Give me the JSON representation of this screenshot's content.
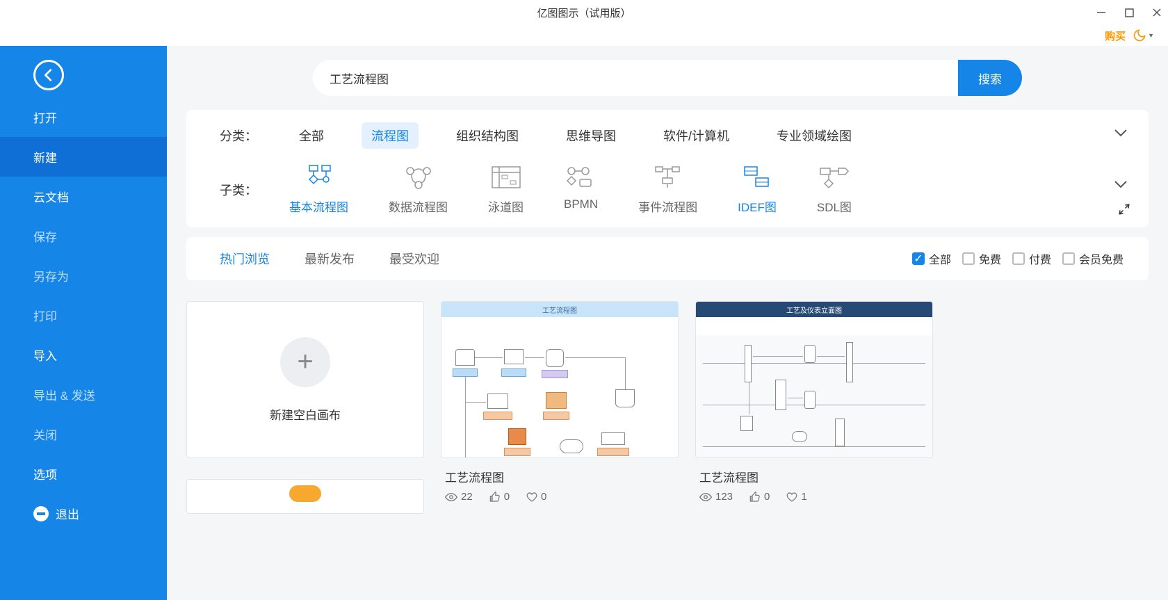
{
  "title": "亿图图示（试用版）",
  "buy": "购买",
  "sidebar": {
    "items": [
      {
        "label": "打开"
      },
      {
        "label": "新建"
      },
      {
        "label": "云文档"
      },
      {
        "label": "保存"
      },
      {
        "label": "另存为"
      },
      {
        "label": "打印"
      },
      {
        "label": "导入"
      },
      {
        "label": "导出 & 发送"
      },
      {
        "label": "关闭"
      },
      {
        "label": "选项"
      },
      {
        "label": "退出"
      }
    ]
  },
  "search": {
    "value": "工艺流程图",
    "button": "搜索"
  },
  "category": {
    "label": "分类：",
    "items": [
      {
        "label": "全部"
      },
      {
        "label": "流程图"
      },
      {
        "label": "组织结构图"
      },
      {
        "label": "思维导图"
      },
      {
        "label": "软件/计算机"
      },
      {
        "label": "专业领域绘图"
      }
    ]
  },
  "subcategory": {
    "label": "子类：",
    "items": [
      {
        "label": "基本流程图"
      },
      {
        "label": "数据流程图"
      },
      {
        "label": "泳道图"
      },
      {
        "label": "BPMN"
      },
      {
        "label": "事件流程图"
      },
      {
        "label": "IDEF图"
      },
      {
        "label": "SDL图"
      }
    ]
  },
  "filterTabs": [
    {
      "label": "热门浏览"
    },
    {
      "label": "最新发布"
    },
    {
      "label": "最受欢迎"
    }
  ],
  "filterChecks": [
    {
      "label": "全部",
      "checked": true
    },
    {
      "label": "免费",
      "checked": false
    },
    {
      "label": "付费",
      "checked": false
    },
    {
      "label": "会员免费",
      "checked": false
    }
  ],
  "blankCard": {
    "label": "新建空白画布"
  },
  "templates": [
    {
      "title": "工艺流程图",
      "previewTitle": "工艺流程图",
      "views": "22",
      "likes": "0",
      "favs": "0",
      "theme": "t1"
    },
    {
      "title": "工艺流程图",
      "previewTitle": "工艺及仪表立面图",
      "views": "123",
      "likes": "0",
      "favs": "1",
      "theme": "t2"
    }
  ]
}
